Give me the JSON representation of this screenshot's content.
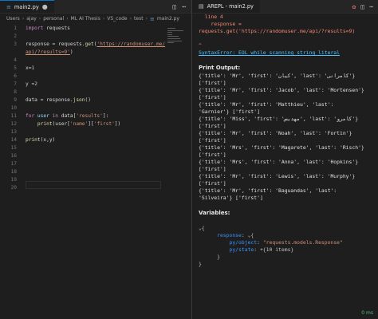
{
  "left": {
    "tab_label": "main2.py",
    "breadcrumb": [
      "Users",
      "ajay",
      "personal",
      "ML AI Thesis",
      "VS_code",
      "test",
      "main2.py"
    ],
    "line_numbers": [
      "1",
      "2",
      "3",
      "",
      "4",
      "5",
      "6",
      "7",
      "8",
      "9",
      "10",
      "11",
      "12",
      "13",
      "14",
      "15",
      "16",
      "17",
      "18",
      "19",
      "20"
    ],
    "code": {
      "l1_kw": "import",
      "l1_rest": " requests",
      "l3_a": "response = requests.",
      "l3_fn": "get",
      "l3_b": "(",
      "l3_url": "'https://randomuser.me/",
      "l3_url2": "api/?results=9'",
      "l3_c": ")",
      "l5_a": "x=",
      "l5_num": "1",
      "l7_a": "y =",
      "l7_num": "2",
      "l9_a": "data = response.",
      "l9_fn": "json",
      "l9_b": "()",
      "l11_kw": "for",
      "l11_var": " user ",
      "l11_kw2": "in",
      "l11_b": " data[",
      "l11_str": "'results'",
      "l11_c": "]:",
      "l12_pad": "    ",
      "l12_fn": "print",
      "l12_a": "(user[",
      "l12_str": "'name'",
      "l12_b": "][",
      "l12_str2": "'first'",
      "l12_c": "])",
      "l14_fn": "print",
      "l14_a": "(x,y)"
    }
  },
  "right": {
    "tab_label": "AREPL - main2.py",
    "error_lines": [
      "  line 4",
      "    response =",
      "requests.get('https://randomuser.me/api/?results=9)",
      "",
      "^"
    ],
    "error_link": "SyntaxError: EOL while scanning string literal",
    "print_header": "Print Output:",
    "print_lines": [
      "{'title': 'Mr', 'first': 'کیان', 'last': 'کامرانی'}",
      "['first']",
      "{'title': 'Mr', 'first': 'Jacob', 'last': 'Mortensen'}",
      "['first']",
      "{'title': 'Mr', 'first': 'Matthieu', 'last':",
      "'Garnier'} ['first']",
      "{'title': 'Miss', 'first': 'مهدیس', 'last': 'کامرو'}",
      "['first']",
      "{'title': 'Mr', 'first': 'Noah', 'last': 'Fortin'}",
      "['first']",
      "{'title': 'Mrs', 'first': 'Magarete', 'last': 'Risch'}",
      "['first']",
      "{'title': 'Mrs', 'first': 'Anna', 'last': 'Hopkins'}",
      "['first']",
      "{'title': 'Mr', 'first': 'Lewis', 'last': 'Murphy'}",
      "['first']",
      "{'title': 'Mr', 'first': 'Baguandas', 'last':",
      "'Silveira'} ['first']"
    ],
    "variables_header": "Variables:",
    "vars": {
      "open": "⌄{",
      "resp_key": "response",
      "resp_open": ": ⌄{",
      "pyobj_key": "py/object",
      "pyobj_val": "\"requests.models.Response\"",
      "pystate_key": "py/state",
      "pystate_val": ": +{10 items}",
      "close_inner": "}",
      "close_outer": "}"
    },
    "status": "0 ms"
  }
}
